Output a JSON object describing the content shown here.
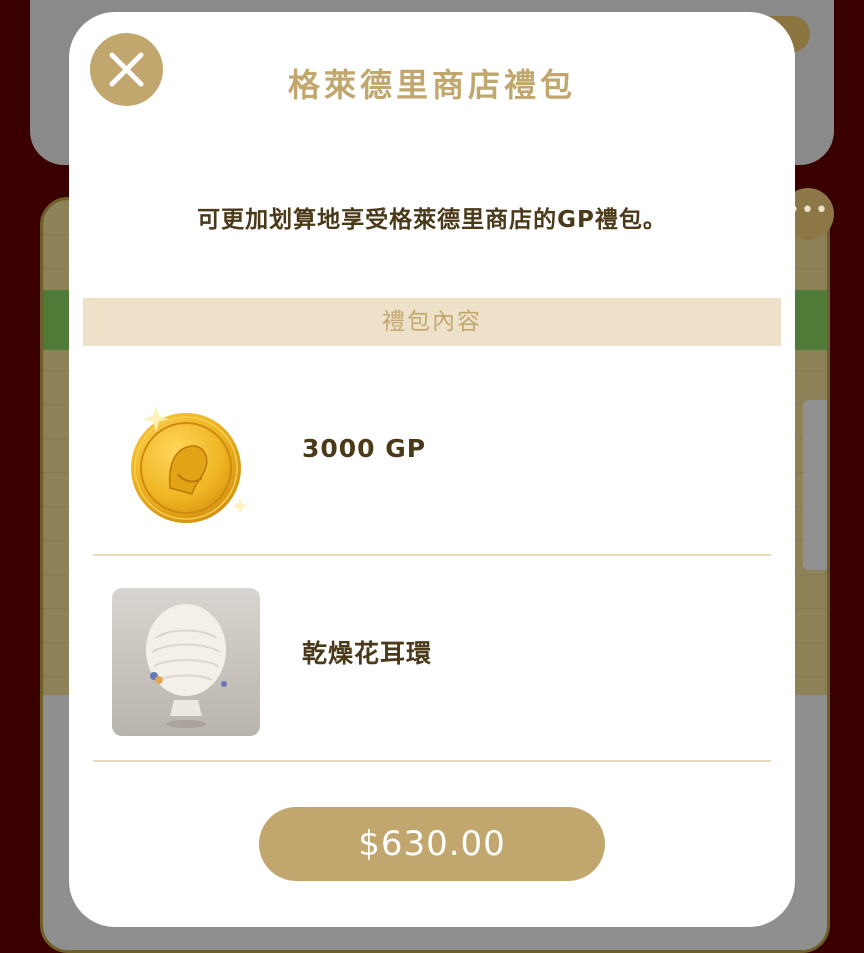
{
  "modal": {
    "title": "格萊德里商店禮包",
    "description": "可更加划算地享受格萊德里商店的GP禮包。",
    "section_header": "禮包內容",
    "items": [
      {
        "label": "3000 GP",
        "icon": "gold-coin-icon"
      },
      {
        "label": "乾燥花耳環",
        "icon": "earring-mannequin-image"
      }
    ],
    "price_label": "$630.00",
    "close_icon": "close-icon"
  },
  "background": {
    "more_label": "•••"
  },
  "colors": {
    "accent_gold": "#c1a76e",
    "section_bg": "#ede2c9",
    "text_brown": "#4b3a19",
    "page_bg": "#3a0000"
  }
}
